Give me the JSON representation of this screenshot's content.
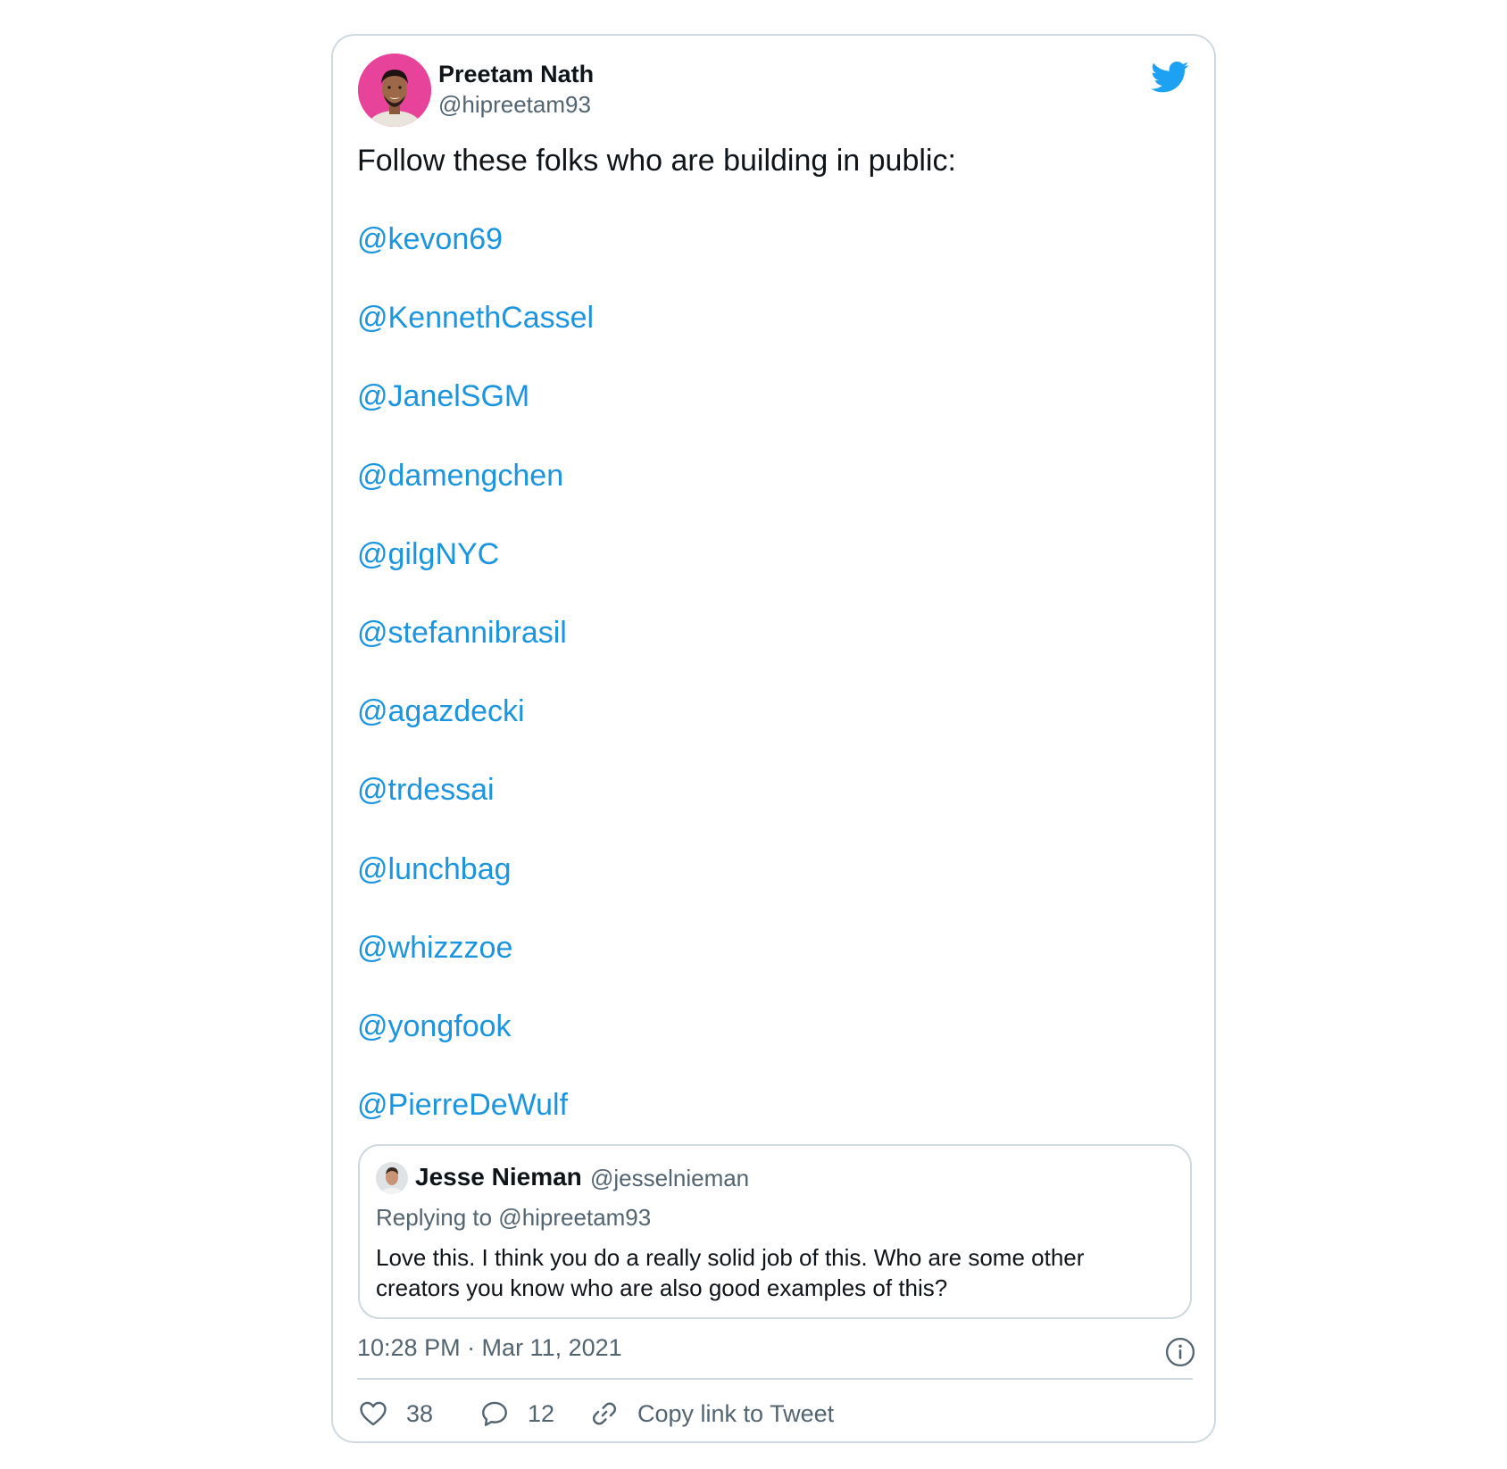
{
  "tweet": {
    "author": {
      "name": "Preetam Nath",
      "handle": "@hipreetam93"
    },
    "text": "Follow these folks who are building in public:",
    "mentions": [
      "@kevon69",
      "@KennethCassel",
      "@JanelSGM",
      "@damengchen",
      "@gilgNYC",
      "@stefannibrasil",
      "@agazdecki",
      "@trdessai",
      "@lunchbag",
      "@whizzzoe",
      "@yongfook",
      "@PierreDeWulf"
    ],
    "quoted_tweet": {
      "name": "Jesse Nieman",
      "handle": "@jesselnieman",
      "replying_to": "Replying to @hipreetam93",
      "text": "Love this. I think you do a really solid job of this. Who are some other creators you know who are also good examples of this?"
    },
    "timestamp": "10:28 PM · Mar 11, 2021",
    "actions": {
      "likes": "38",
      "replies": "12",
      "copy_link_label": "Copy link to Tweet"
    }
  },
  "colors": {
    "link": "#1b95e0",
    "muted": "#536471",
    "border": "#cfd9de",
    "twitter_blue": "#1da1f2",
    "avatar_bg": "#e8439a"
  },
  "icons": [
    "twitter-bird-icon",
    "info-icon",
    "heart-icon",
    "reply-bubble-icon",
    "link-icon"
  ]
}
